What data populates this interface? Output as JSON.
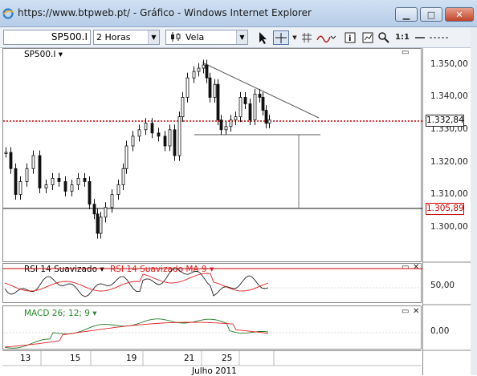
{
  "window": {
    "title": "https://www.btpweb.pt/ - Gráfico - Windows Internet Explorer",
    "min_label": "▁",
    "max_label": "□",
    "close_label": "✕"
  },
  "toolbar": {
    "symbol": "SP500.I",
    "interval": "2 Horas",
    "chart_style": "Vela",
    "zoom_label": "1:1"
  },
  "main_pane": {
    "symbol_label": "SP500.I ▾"
  },
  "price_axis": {
    "ticks": [
      "1.350,00",
      "1.340,00",
      "1.330,00",
      "1.320,00",
      "1.310,00",
      "1.300,00"
    ],
    "current_price": "1.332,84",
    "marked_price": "1.305,89"
  },
  "rsi_pane": {
    "label": "RSI 14 Suavizado ▾",
    "ma_label": "RSI 14 Suavizado MA 9 ▾",
    "tick": "50,00"
  },
  "macd_pane": {
    "label": "MACD 26; 12; 9 ▾",
    "tick": "0,00"
  },
  "x_axis": {
    "days": [
      "13",
      "15",
      "19",
      "21",
      "25"
    ],
    "month": "Julho 2011"
  },
  "colors": {
    "up": "#ffffff",
    "down": "#000000",
    "rsi_ma": "#e02020",
    "current_line": "#cc0000"
  }
}
